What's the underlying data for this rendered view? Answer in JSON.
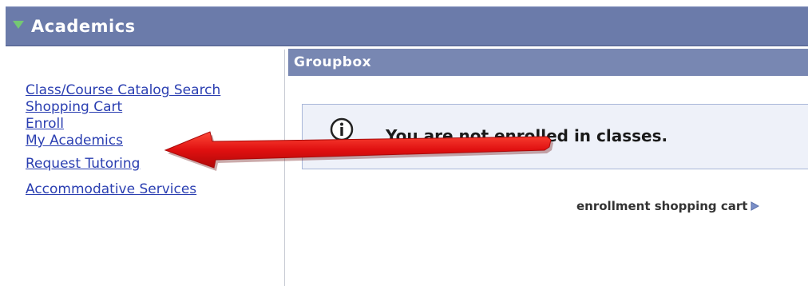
{
  "header": {
    "title": "Academics"
  },
  "nav": {
    "items": [
      {
        "label": "Class/Course Catalog Search"
      },
      {
        "label": "Shopping Cart"
      },
      {
        "label": "Enroll"
      },
      {
        "label": "My Academics"
      },
      {
        "label": "Request Tutoring"
      },
      {
        "label": "Accommodative Services"
      }
    ]
  },
  "groupbox": {
    "title": "Groupbox"
  },
  "message": {
    "text": "You are not enrolled in classes."
  },
  "cart_link": {
    "label": "enrollment shopping cart"
  },
  "colors": {
    "header_bg": "#6b7baa",
    "groupbox_bg": "#7887b2",
    "link": "#2a3eb1",
    "arrow": "#e01010",
    "message_bg": "#eef1f9"
  },
  "icons": [
    "expand-triangle-icon",
    "info-icon",
    "play-arrow-icon",
    "red-pointer-arrow"
  ]
}
